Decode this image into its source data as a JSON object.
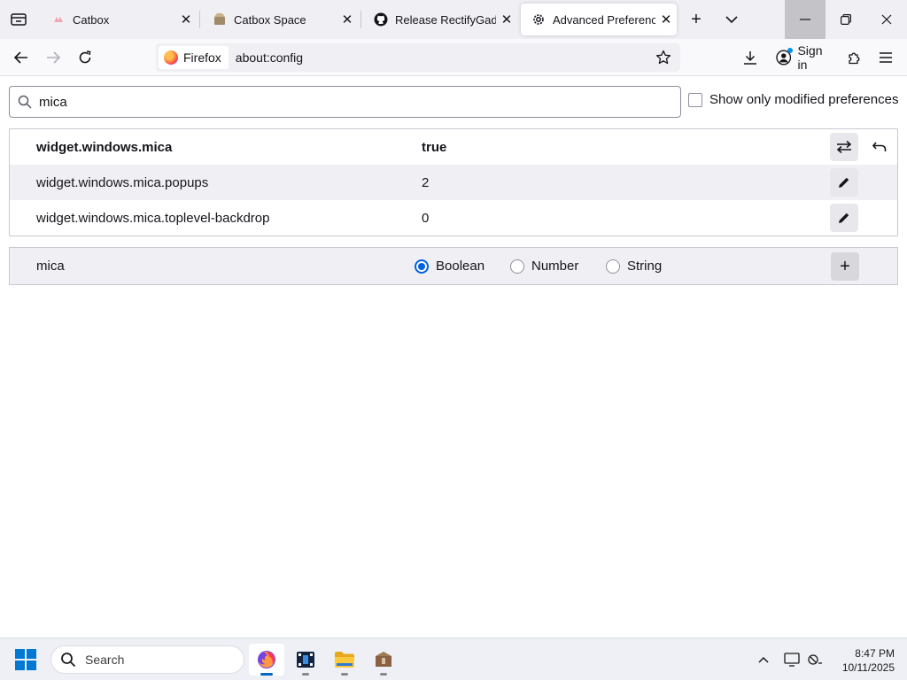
{
  "tabs": [
    {
      "title": "Catbox",
      "favicon": "catbox-icon"
    },
    {
      "title": "Catbox Space",
      "favicon": "catbox-space-icon"
    },
    {
      "title": "Release RectifyGadgets",
      "favicon": "github-icon"
    },
    {
      "title": "Advanced Preferences",
      "favicon": "gear-icon",
      "selected": true
    }
  ],
  "nav": {
    "identity_label": "Firefox",
    "url": "about:config",
    "signin_label": "Sign in"
  },
  "search": {
    "value": "mica"
  },
  "modified_toggle": {
    "label": "Show only modified preferences",
    "checked": false
  },
  "prefs": [
    {
      "name": "widget.windows.mica",
      "value": "true",
      "modified": true
    },
    {
      "name": "widget.windows.mica.popups",
      "value": "2",
      "modified": false
    },
    {
      "name": "widget.windows.mica.toplevel-backdrop",
      "value": "0",
      "modified": false
    }
  ],
  "add_row": {
    "name": "mica",
    "types": [
      {
        "label": "Boolean",
        "checked": true
      },
      {
        "label": "Number",
        "checked": false
      },
      {
        "label": "String",
        "checked": false
      }
    ]
  },
  "taskbar": {
    "search_placeholder": "Search",
    "time": "8:47 PM",
    "date": "10/11/2025"
  },
  "colors": {
    "accent": "#0061e0",
    "toolbar": "#f9f9fb",
    "tabstrip": "#f0f0f4"
  }
}
